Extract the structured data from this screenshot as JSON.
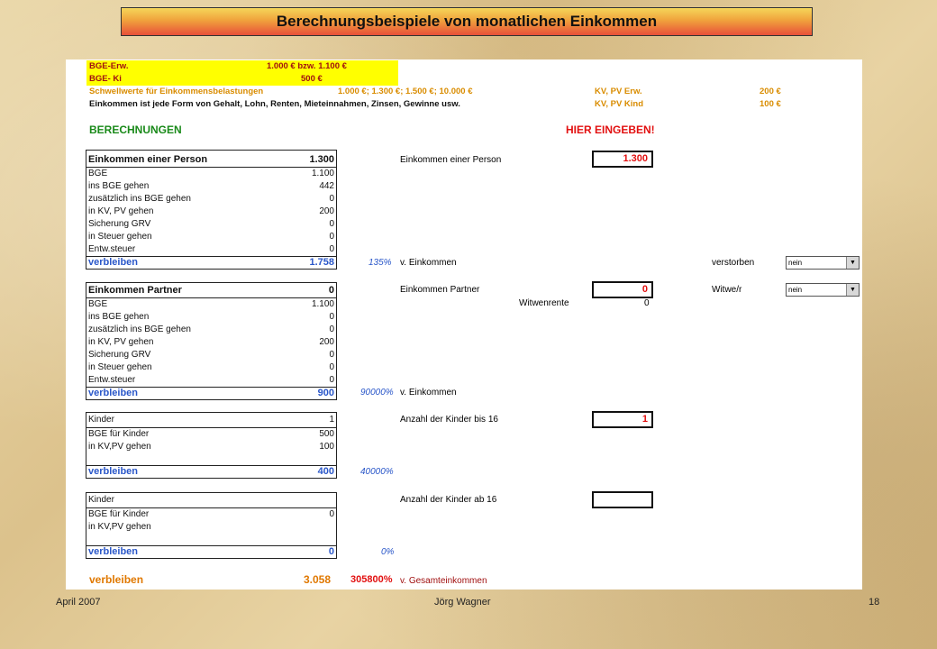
{
  "slide": {
    "title": "Berechnungsbeispiele von monatlichen Einkommen",
    "footer_left": "April 2007",
    "footer_center": "Jörg Wagner",
    "footer_right": "18"
  },
  "header": {
    "bge_erw_label": "BGE-Erw.",
    "bge_erw_value": "1.000 € bzw. 1.100 €",
    "bge_ki_label": "BGE- Ki",
    "bge_ki_value": "500 €",
    "schwell_label": "Schwellwerte für Einkommensbelastungen",
    "schwell_value": "1.000 €; 1.300 €; 1.500 €; 10.000 €",
    "kv_erw_label": "KV, PV Erw.",
    "kv_erw_value": "200 €",
    "einkommen_text": "Einkommen ist jede Form von Gehalt, Lohn, Renten, Mieteinnahmen, Zinsen, Gewinne usw.",
    "kv_kind_label": "KV, PV Kind",
    "kv_kind_value": "100 €"
  },
  "section": {
    "berechnungen": "BERECHNUNGEN",
    "hier_eingeben": "HIER EINGEBEN!"
  },
  "person": {
    "title": "Einkommen einer Person",
    "title_value": "1.300",
    "rows": [
      {
        "label": "BGE",
        "value": "1.100"
      },
      {
        "label": "ins BGE gehen",
        "value": "442"
      },
      {
        "label": "zusätzlich ins BGE gehen",
        "value": "0"
      },
      {
        "label": "in KV, PV gehen",
        "value": "200"
      },
      {
        "label": "Sicherung GRV",
        "value": "0"
      },
      {
        "label": "in Steuer gehen",
        "value": "0"
      },
      {
        "label": "Entw.steuer",
        "value": "0"
      }
    ],
    "verbleiben_label": "verbleiben",
    "verbleiben_value": "1.758",
    "percent": "135%",
    "percent_label": "v. Einkommen",
    "input_label": "Einkommen einer Person",
    "input_value": "1.300",
    "verstorben_label": "verstorben",
    "verstorben_value": "nein"
  },
  "partner": {
    "title": "Einkommen Partner",
    "title_value": "0",
    "rows": [
      {
        "label": "BGE",
        "value": "1.100"
      },
      {
        "label": "ins BGE gehen",
        "value": "0"
      },
      {
        "label": "zusätzlich ins BGE gehen",
        "value": "0"
      },
      {
        "label": "in KV, PV gehen",
        "value": "200"
      },
      {
        "label": "Sicherung GRV",
        "value": "0"
      },
      {
        "label": "in Steuer gehen",
        "value": "0"
      },
      {
        "label": "Entw.steuer",
        "value": "0"
      }
    ],
    "verbleiben_label": "verbleiben",
    "verbleiben_value": "900",
    "percent": "90000%",
    "percent_label": "v. Einkommen",
    "input_label": "Einkommen Partner",
    "input_value": "0",
    "witwenrente_label": "Witwenrente",
    "witwenrente_value": "0",
    "witwe_label": "Witwe/r",
    "witwe_value": "nein"
  },
  "kinder16": {
    "rows": [
      {
        "label": "Kinder",
        "value": "1"
      },
      {
        "label": "BGE für Kinder",
        "value": "500"
      },
      {
        "label": "in KV,PV gehen",
        "value": "100"
      }
    ],
    "verbleiben_label": "verbleiben",
    "verbleiben_value": "400",
    "percent": "40000%",
    "input_label": "Anzahl der Kinder bis 16",
    "input_value": "1"
  },
  "kinderab16": {
    "rows": [
      {
        "label": "Kinder",
        "value": ""
      },
      {
        "label": "BGE für Kinder",
        "value": "0"
      },
      {
        "label": "in KV,PV gehen",
        "value": ""
      }
    ],
    "verbleiben_label": "verbleiben",
    "verbleiben_value": "0",
    "percent": "0%",
    "input_label": "Anzahl der Kinder ab 16",
    "input_value": ""
  },
  "total": {
    "verbleiben_label": "verbleiben",
    "verbleiben_value": "3.058",
    "percent": "305800%",
    "percent_label": "v. Gesamteinkommen"
  }
}
